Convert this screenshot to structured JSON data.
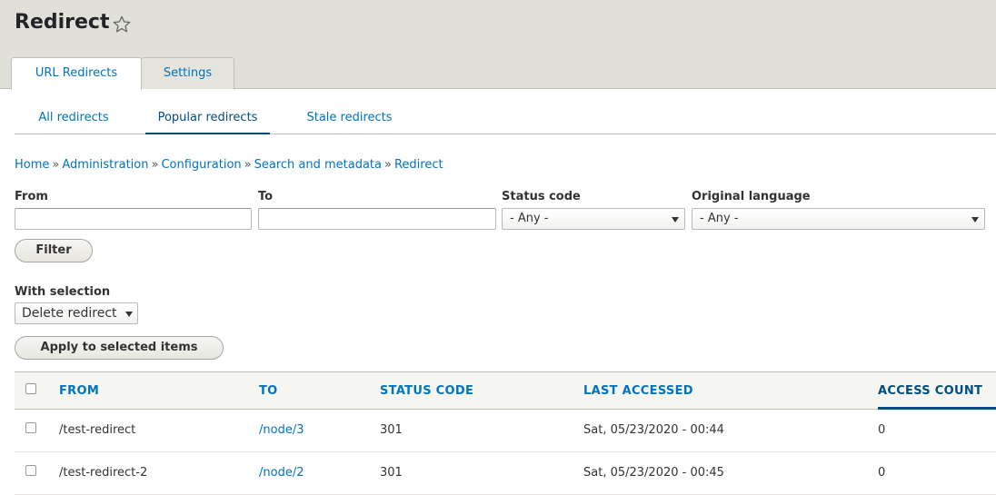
{
  "header": {
    "title": "Redirect",
    "tabs": [
      {
        "label": "URL Redirects",
        "active": true
      },
      {
        "label": "Settings",
        "active": false
      }
    ]
  },
  "subtabs": [
    {
      "label": "All redirects",
      "active": false
    },
    {
      "label": "Popular redirects",
      "active": true
    },
    {
      "label": "Stale redirects",
      "active": false
    }
  ],
  "breadcrumb": [
    "Home",
    "Administration",
    "Configuration",
    "Search and metadata",
    "Redirect"
  ],
  "breadcrumb_separator": "»",
  "filters": {
    "from": {
      "label": "From",
      "value": ""
    },
    "to": {
      "label": "To",
      "value": ""
    },
    "status_code": {
      "label": "Status code",
      "selected": "- Any -"
    },
    "language": {
      "label": "Original language",
      "selected": "- Any -"
    },
    "filter_button": "Filter"
  },
  "bulk": {
    "label": "With selection",
    "selected": "Delete redirect",
    "apply_button": "Apply to selected items"
  },
  "table": {
    "columns": [
      "FROM",
      "TO",
      "STATUS CODE",
      "LAST ACCESSED",
      "ACCESS COUNT"
    ],
    "sorted_column": "ACCESS COUNT",
    "rows": [
      {
        "from": "/test-redirect",
        "to": "/node/3",
        "status": "301",
        "last_accessed": "Sat, 05/23/2020 - 00:44",
        "count": "0"
      },
      {
        "from": "/test-redirect-2",
        "to": "/node/2",
        "status": "301",
        "last_accessed": "Sat, 05/23/2020 - 00:45",
        "count": "0"
      }
    ]
  },
  "colors": {
    "link": "#0074bd",
    "link_active": "#004f80",
    "header_bg": "#e0e0d8"
  },
  "icons": {
    "favorite": "star-outline-icon",
    "dropdown": "chevron-down-icon"
  }
}
